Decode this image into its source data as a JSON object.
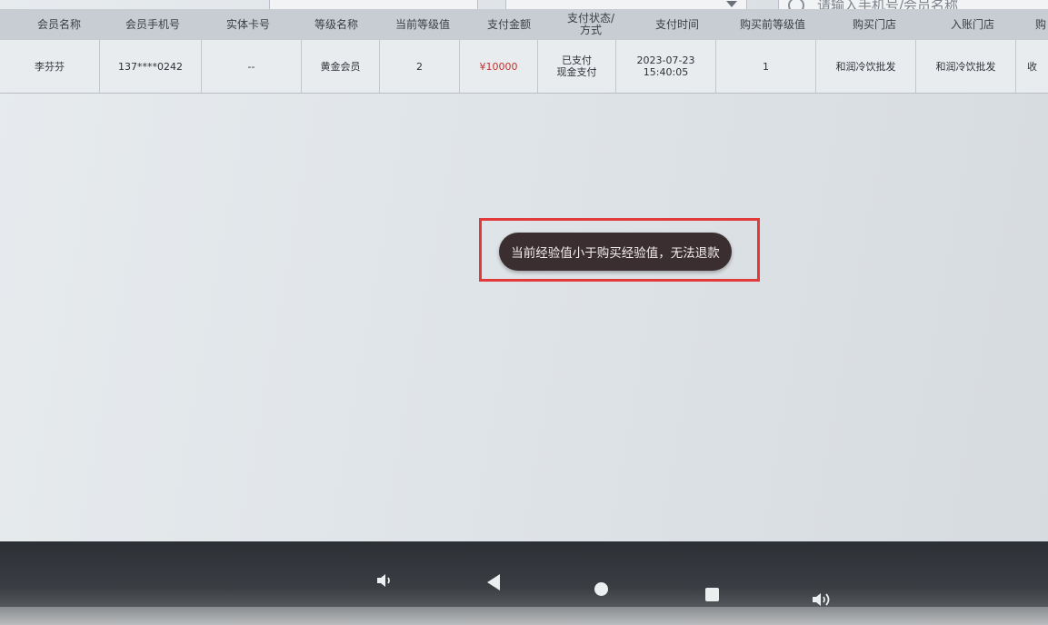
{
  "search": {
    "placeholder": "请输入手机号/会员名称"
  },
  "table": {
    "headers": [
      "会员名称",
      "会员手机号",
      "实体卡号",
      "等级名称",
      "当前等级值",
      "支付金额",
      "支付状态/\n方式",
      "支付时间",
      "购买前等级值",
      "购买门店",
      "入账门店",
      "购"
    ],
    "rows": [
      {
        "member_name": "李芬芬",
        "phone": "137****0242",
        "card_no": "--",
        "level_name": "黄金会员",
        "current_level_value": "2",
        "amount": "¥10000",
        "pay_status": "已支付",
        "pay_method": "现金支付",
        "pay_date": "2023-07-23",
        "pay_time": "15:40:05",
        "level_before": "1",
        "buy_store": "和润冷饮批发",
        "account_store": "和润冷饮批发",
        "extra": "收"
      }
    ]
  },
  "toast": {
    "message": "当前经验值小于购买经验值，无法退款"
  },
  "colors": {
    "highlight_border": "#e23a3a",
    "amount": "#c0312f",
    "toast_bg": "#3b2e30"
  },
  "navbar": {
    "icons": [
      "volume-down-icon",
      "back-icon",
      "home-icon",
      "recent-apps-icon",
      "volume-up-icon"
    ]
  }
}
